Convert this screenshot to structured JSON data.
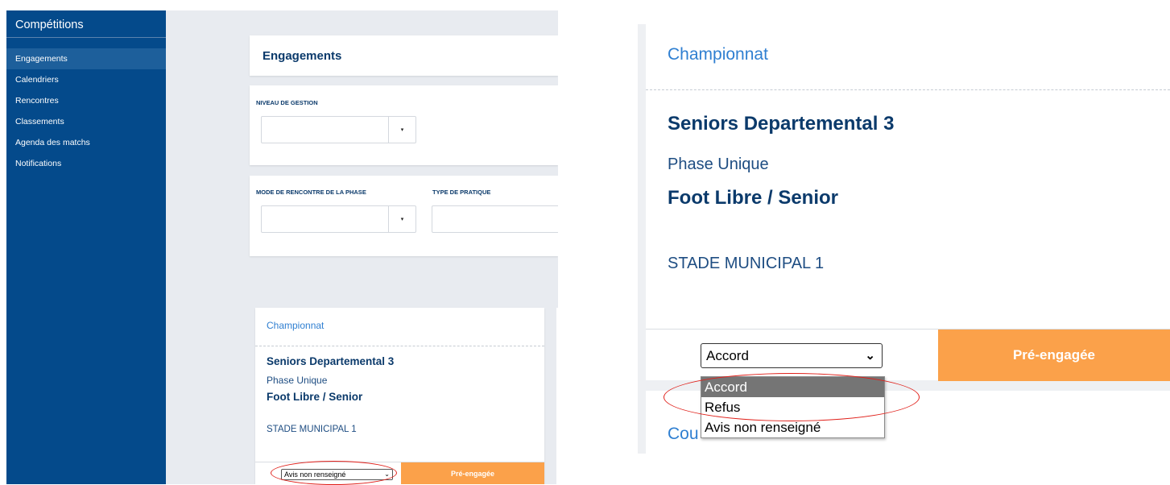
{
  "sidebar": {
    "title": "Compétitions",
    "items": [
      {
        "label": "Engagements"
      },
      {
        "label": "Calendriers"
      },
      {
        "label": "Rencontres"
      },
      {
        "label": "Classements"
      },
      {
        "label": "Agenda des matchs"
      },
      {
        "label": "Notifications"
      }
    ],
    "active_index": 0
  },
  "page": {
    "title": "Engagements"
  },
  "filters": {
    "niveau_label": "NIVEAU DE GESTION",
    "niveau_value": "",
    "mode_label": "MODE DE RENCONTRE DE LA PHASE",
    "mode_value": "",
    "type_label": "TYPE DE PRATIQUE",
    "type_value": "",
    "dropdown_arrow": "▾"
  },
  "card": {
    "type": "Championnat",
    "name": "Seniors Departemental 3",
    "phase": "Phase Unique",
    "pratique": "Foot Libre / Senior",
    "stade": "STADE MUNICIPAL 1",
    "avis_selected_left": "Avis non renseigné",
    "avis_selected_right": "Accord",
    "status": "Pré-engagée",
    "next_card_type_partial": "Cou"
  },
  "avis_options": [
    {
      "label": "Accord"
    },
    {
      "label": "Refus"
    },
    {
      "label": "Avis non renseigné"
    }
  ],
  "icons": {
    "select_chevron": "chevron-down-icon"
  },
  "colors": {
    "sidebar_bg": "#044a8b",
    "accent_orange": "#fba14a",
    "link_blue": "#2f7fd1",
    "highlight_red": "#e0201a"
  }
}
